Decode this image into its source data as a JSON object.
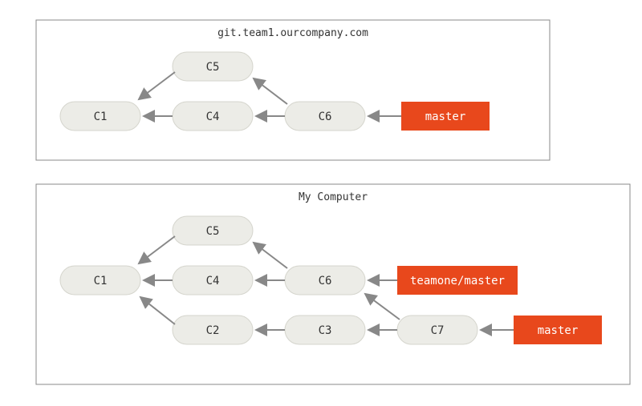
{
  "remote": {
    "title": "git.team1.ourcompany.com",
    "commits": {
      "c1": "C1",
      "c4": "C4",
      "c5": "C5",
      "c6": "C6"
    },
    "refs": {
      "master": "master"
    }
  },
  "local": {
    "title": "My Computer",
    "commits": {
      "c1": "C1",
      "c2": "C2",
      "c3": "C3",
      "c4": "C4",
      "c5": "C5",
      "c6": "C6",
      "c7": "C7"
    },
    "refs": {
      "teamone_master": "teamone/master",
      "master": "master"
    }
  }
}
